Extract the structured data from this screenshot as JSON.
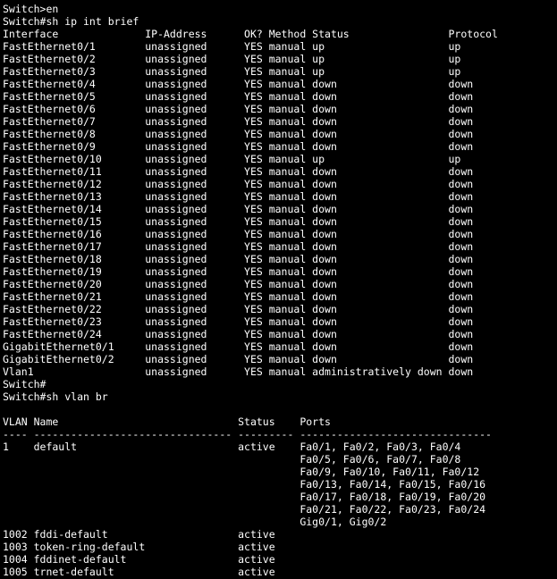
{
  "terminal": {
    "lines": [
      "Switch>en",
      "Switch#sh ip int brief",
      "Interface              IP-Address      OK? Method Status                Protocol",
      "FastEthernet0/1        unassigned      YES manual up                    up",
      "FastEthernet0/2        unassigned      YES manual up                    up",
      "FastEthernet0/3        unassigned      YES manual up                    up",
      "FastEthernet0/4        unassigned      YES manual down                  down",
      "FastEthernet0/5        unassigned      YES manual down                  down",
      "FastEthernet0/6        unassigned      YES manual down                  down",
      "FastEthernet0/7        unassigned      YES manual down                  down",
      "FastEthernet0/8        unassigned      YES manual down                  down",
      "FastEthernet0/9        unassigned      YES manual down                  down",
      "FastEthernet0/10       unassigned      YES manual up                    up",
      "FastEthernet0/11       unassigned      YES manual down                  down",
      "FastEthernet0/12       unassigned      YES manual down                  down",
      "FastEthernet0/13       unassigned      YES manual down                  down",
      "FastEthernet0/14       unassigned      YES manual down                  down",
      "FastEthernet0/15       unassigned      YES manual down                  down",
      "FastEthernet0/16       unassigned      YES manual down                  down",
      "FastEthernet0/17       unassigned      YES manual down                  down",
      "FastEthernet0/18       unassigned      YES manual down                  down",
      "FastEthernet0/19       unassigned      YES manual down                  down",
      "FastEthernet0/20       unassigned      YES manual down                  down",
      "FastEthernet0/21       unassigned      YES manual down                  down",
      "FastEthernet0/22       unassigned      YES manual down                  down",
      "FastEthernet0/23       unassigned      YES manual down                  down",
      "FastEthernet0/24       unassigned      YES manual down                  down",
      "GigabitEthernet0/1     unassigned      YES manual down                  down",
      "GigabitEthernet0/2     unassigned      YES manual down                  down",
      "Vlan1                  unassigned      YES manual administratively down down",
      "Switch#",
      "Switch#sh vlan br",
      "",
      "VLAN Name                             Status    Ports",
      "---- -------------------------------- --------- -------------------------------",
      "1    default                          active    Fa0/1, Fa0/2, Fa0/3, Fa0/4",
      "                                                Fa0/5, Fa0/6, Fa0/7, Fa0/8",
      "                                                Fa0/9, Fa0/10, Fa0/11, Fa0/12",
      "                                                Fa0/13, Fa0/14, Fa0/15, Fa0/16",
      "                                                Fa0/17, Fa0/18, Fa0/19, Fa0/20",
      "                                                Fa0/21, Fa0/22, Fa0/23, Fa0/24",
      "                                                Gig0/1, Gig0/2",
      "1002 fddi-default                     active",
      "1003 token-ring-default               active",
      "1004 fddinet-default                  active",
      "1005 trnet-default                    active"
    ],
    "colors": {
      "background": "#000000",
      "text": "#ffffff"
    }
  }
}
